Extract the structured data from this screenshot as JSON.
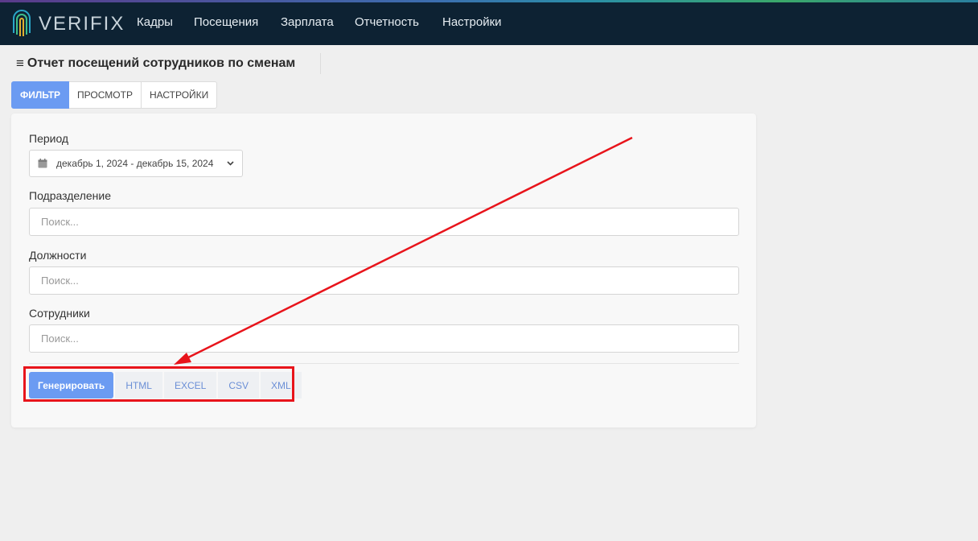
{
  "app": {
    "brand": "VERIFIX",
    "nav": [
      "Кадры",
      "Посещения",
      "Зарплата",
      "Отчетность",
      "Настройки"
    ]
  },
  "page": {
    "title": "Отчет посещений сотрудников по сменам"
  },
  "tabs": [
    "ФИЛЬТР",
    "ПРОСМОТР",
    "НАСТРОЙКИ"
  ],
  "filter": {
    "period_label": "Период",
    "period_value": "декабрь 1, 2024 - декабрь 15, 2024",
    "division_label": "Подразделение",
    "division_placeholder": "Поиск...",
    "positions_label": "Должности",
    "positions_placeholder": "Поиск...",
    "employees_label": "Сотрудники",
    "employees_placeholder": "Поиск..."
  },
  "actions": {
    "generate": "Генерировать",
    "formats": [
      "HTML",
      "EXCEL",
      "CSV",
      "XML"
    ]
  },
  "colors": {
    "navbar": "#0d2233",
    "accent": "#6b9bf2",
    "annotation": "#e8141b"
  }
}
